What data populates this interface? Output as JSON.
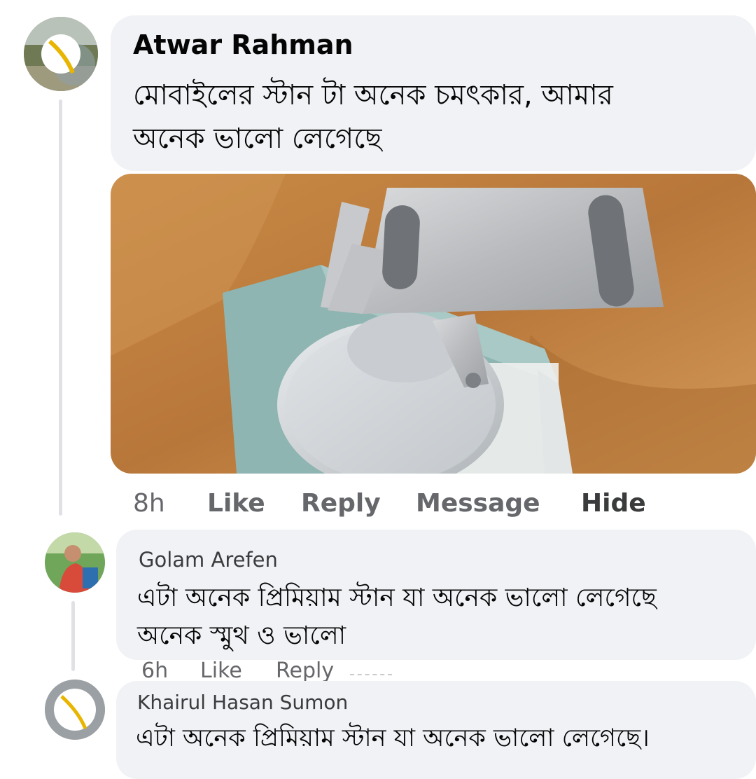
{
  "comments": [
    {
      "author": "Atwar Rahman",
      "text_line1": "মোবাইলের স্টান টা অনেক চমৎকার, আমার",
      "text_line2": "অনেক ভালো লেগেছে",
      "time": "8h",
      "actions": [
        "Like",
        "Reply",
        "Message",
        "Hide"
      ]
    },
    {
      "author": "Golam Arefen",
      "text_line1": "এটা অনেক প্রিমিয়াম স্টান যা অনেক ভালো লেগেছে",
      "text_line2": "অনেক স্মুথ ও ভালো",
      "time": "6h",
      "actions": [
        "Like",
        "Reply"
      ]
    },
    {
      "author": "Khairul Hasan Sumon",
      "text_line1": "এটা অনেক প্রিমিয়াম স্টান যা অনেক ভালো লেগেছে।"
    }
  ],
  "colors": {
    "bubble": "#f0f2f5",
    "muted_text": "#65676b",
    "thread_line": "#dfe1e5"
  }
}
